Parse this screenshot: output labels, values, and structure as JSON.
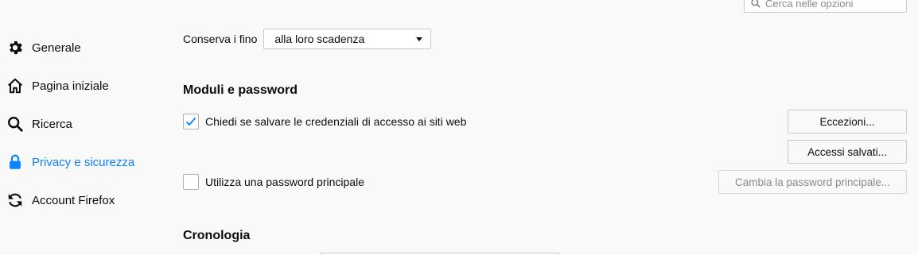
{
  "search": {
    "placeholder": "Cerca nelle opzioni"
  },
  "sidebar": {
    "items": [
      {
        "label": "Generale",
        "icon": "gear-icon",
        "active": false
      },
      {
        "label": "Pagina iniziale",
        "icon": "home-icon",
        "active": false
      },
      {
        "label": "Ricerca",
        "icon": "search-icon",
        "active": false
      },
      {
        "label": "Privacy e sicurezza",
        "icon": "lock-icon",
        "active": true
      },
      {
        "label": "Account Firefox",
        "icon": "sync-icon",
        "active": false
      }
    ]
  },
  "history_keep": {
    "label": "Conserva i fino",
    "value": "alla loro scadenza"
  },
  "forms_section": {
    "title": "Moduli e password",
    "ask_save_label": "Chiedi se salvare le credenziali di accesso ai siti web",
    "ask_save_checked": true,
    "exceptions_button": "Eccezioni...",
    "saved_logins_button": "Accessi salvati...",
    "master_password_label": "Utilizza una password principale",
    "master_password_checked": false,
    "change_master_button": "Cambia la password principale..."
  },
  "history_section": {
    "title": "Cronologia"
  },
  "colors": {
    "accent": "#0a84ff",
    "background": "#f9f9fa"
  }
}
